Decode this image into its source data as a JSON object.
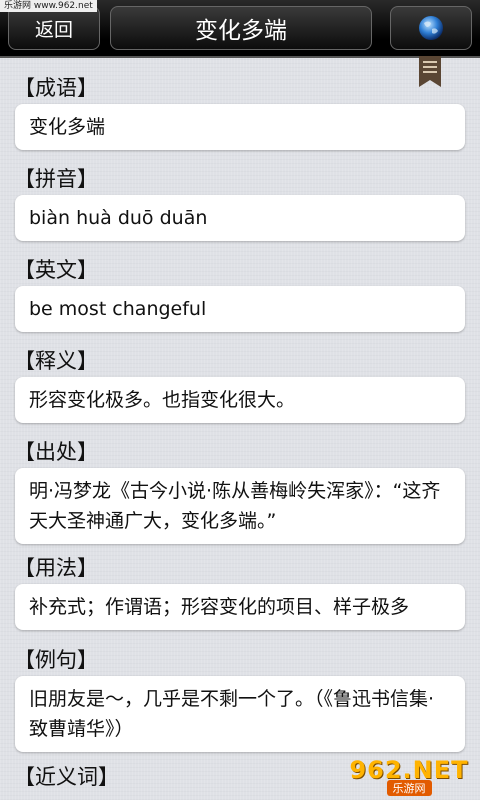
{
  "watermark": {
    "text": "乐游网 www.962.net"
  },
  "header": {
    "back_label": "返回",
    "title": "变化多端"
  },
  "sections": [
    {
      "label": "【成语】",
      "content": "变化多端"
    },
    {
      "label": "【拼音】",
      "content": "biàn huà duō duān"
    },
    {
      "label": "【英文】",
      "content": "be most changeful"
    },
    {
      "label": "【释义】",
      "content": "形容变化极多。也指变化很大。"
    },
    {
      "label": "【出处】",
      "content": "明·冯梦龙《古今小说·陈从善梅岭失浑家》：“这齐天大圣神通广大，变化多端。”"
    },
    {
      "label": "【用法】",
      "content": "补充式；作谓语；形容变化的项目、样子极多"
    },
    {
      "label": "【例句】",
      "content": "旧朋友是～，几乎是不剩一个了。（《鲁迅书信集·致曹靖华》）"
    },
    {
      "label": "【近义词】"
    }
  ],
  "brand": {
    "main": "962.NET",
    "sub": "乐游网"
  },
  "icons": {
    "globe": "globe-icon",
    "bookmark": "bookmark-icon"
  },
  "colors": {
    "topbar": "#000000",
    "background": "#dfe1e6",
    "card": "#ffffff",
    "brand_orange": "#ffb300"
  }
}
